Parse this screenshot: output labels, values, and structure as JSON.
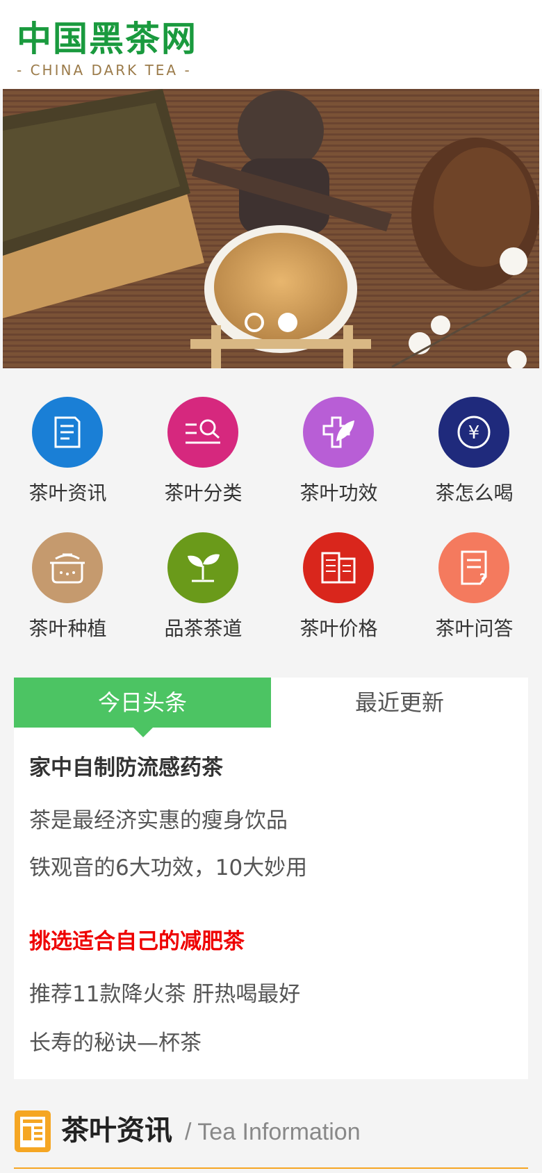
{
  "header": {
    "logo_cn": "中国黑茶网",
    "logo_en": "- CHINA DARK TEA -"
  },
  "banner": {
    "slide_count": 2,
    "active_slide": 2
  },
  "nav_grid": {
    "items": [
      {
        "label": "茶叶资讯",
        "icon": "document-icon",
        "color": "#1a7fd6"
      },
      {
        "label": "茶叶分类",
        "icon": "list-search-icon",
        "color": "#d6287e"
      },
      {
        "label": "茶叶功效",
        "icon": "leaf-cross-icon",
        "color": "#b85ed6"
      },
      {
        "label": "茶怎么喝",
        "icon": "yuan-icon",
        "color": "#1f2a7c"
      },
      {
        "label": "茶叶种植",
        "icon": "pot-icon",
        "color": "#c59a6e"
      },
      {
        "label": "品茶茶道",
        "icon": "sprout-icon",
        "color": "#6a9a1a"
      },
      {
        "label": "茶叶价格",
        "icon": "building-icon",
        "color": "#d9261c"
      },
      {
        "label": "茶叶问答",
        "icon": "question-doc-icon",
        "color": "#f47a5e"
      }
    ]
  },
  "tabs": {
    "active": "今日头条",
    "inactive": "最近更新"
  },
  "news": {
    "group1_headline": "家中自制防流感药茶",
    "group1_items": [
      "茶是最经济实惠的瘦身饮品",
      "铁观音的6大功效，10大妙用"
    ],
    "group2_headline": "挑选适合自己的减肥茶",
    "group2_items": [
      "推荐11款降火茶 肝热喝最好",
      "长寿的秘诀—杯茶"
    ]
  },
  "section": {
    "title_cn": "茶叶资讯",
    "title_en": "/ Tea Information",
    "icon": "news-icon",
    "accent": "#f5a623"
  }
}
